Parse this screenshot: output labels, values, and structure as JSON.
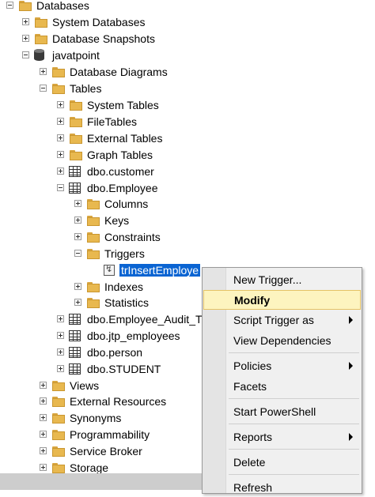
{
  "tree": {
    "databases": "Databases",
    "system_databases": "System Databases",
    "database_snapshots": "Database Snapshots",
    "javatpoint": "javatpoint",
    "database_diagrams": "Database Diagrams",
    "tables": "Tables",
    "system_tables": "System Tables",
    "filetables": "FileTables",
    "external_tables": "External Tables",
    "graph_tables": "Graph Tables",
    "dbo_customer": "dbo.customer",
    "dbo_employee": "dbo.Employee",
    "columns": "Columns",
    "keys": "Keys",
    "constraints": "Constraints",
    "triggers": "Triggers",
    "trigger_item": "trInsertEmploye",
    "indexes": "Indexes",
    "statistics": "Statistics",
    "dbo_employee_audit": "dbo.Employee_Audit_T",
    "dbo_jtp_employees": "dbo.jtp_employees",
    "dbo_person": "dbo.person",
    "dbo_student": "dbo.STUDENT",
    "views": "Views",
    "external_resources": "External Resources",
    "synonyms": "Synonyms",
    "programmability": "Programmability",
    "service_broker": "Service Broker",
    "storage": "Storage"
  },
  "context_menu": {
    "new_trigger": "New Trigger...",
    "modify": "Modify",
    "script_trigger_as": "Script Trigger as",
    "view_dependencies": "View Dependencies",
    "policies": "Policies",
    "facets": "Facets",
    "start_powershell": "Start PowerShell",
    "reports": "Reports",
    "delete": "Delete",
    "refresh": "Refresh"
  },
  "colors": {
    "selection": "#0a64d2",
    "menu_highlight": "#fdf4bf",
    "folder": "#e8b84f"
  }
}
